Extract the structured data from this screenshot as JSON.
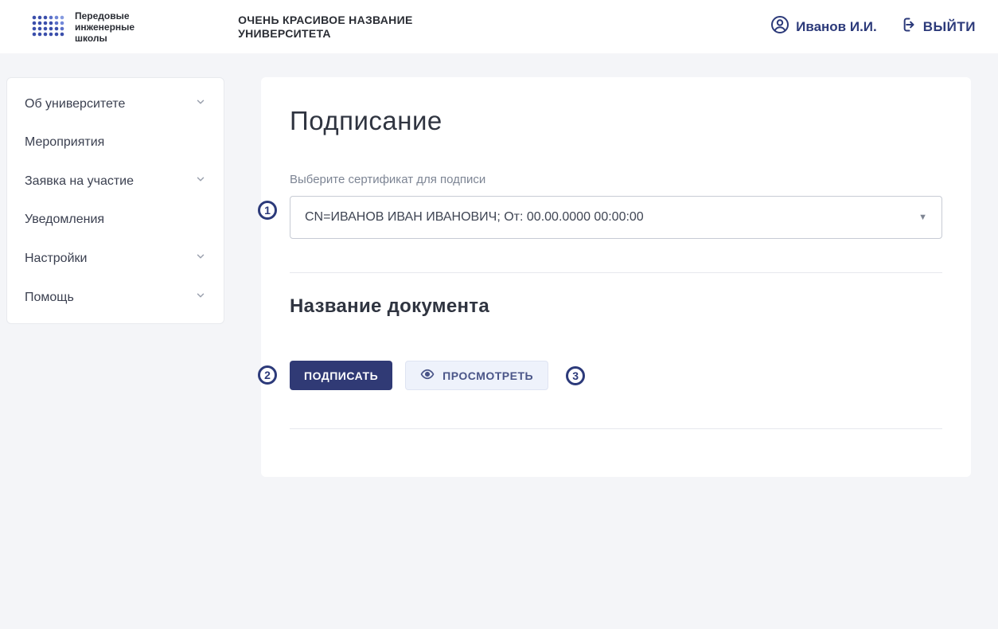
{
  "header": {
    "brand_line1": "Передовые",
    "brand_line2": "инженерные",
    "brand_line3": "школы",
    "university_line1": "ОЧЕНЬ КРАСИВОЕ НАЗВАНИЕ",
    "university_line2": "УНИВЕРСИТЕТА",
    "user_name": "Иванов И.И.",
    "logout_label": "ВЫЙТИ"
  },
  "sidebar": {
    "items": [
      {
        "label": "Об университете",
        "expandable": true
      },
      {
        "label": "Мероприятия",
        "expandable": false
      },
      {
        "label": "Заявка на участие",
        "expandable": true
      },
      {
        "label": "Уведомления",
        "expandable": false
      },
      {
        "label": "Настройки",
        "expandable": true
      },
      {
        "label": "Помощь",
        "expandable": true
      }
    ]
  },
  "main": {
    "page_title": "Подписание",
    "cert_label": "Выберите сертификат для подписи",
    "cert_selected": "CN=ИВАНОВ ИВАН ИВАНОВИЧ; От: 00.00.0000 00:00:00",
    "doc_title": "Название документа",
    "sign_button": "ПОДПИСАТЬ",
    "view_button": "ПРОСМОТРЕТЬ"
  },
  "callouts": {
    "one": "1",
    "two": "2",
    "three": "3"
  }
}
